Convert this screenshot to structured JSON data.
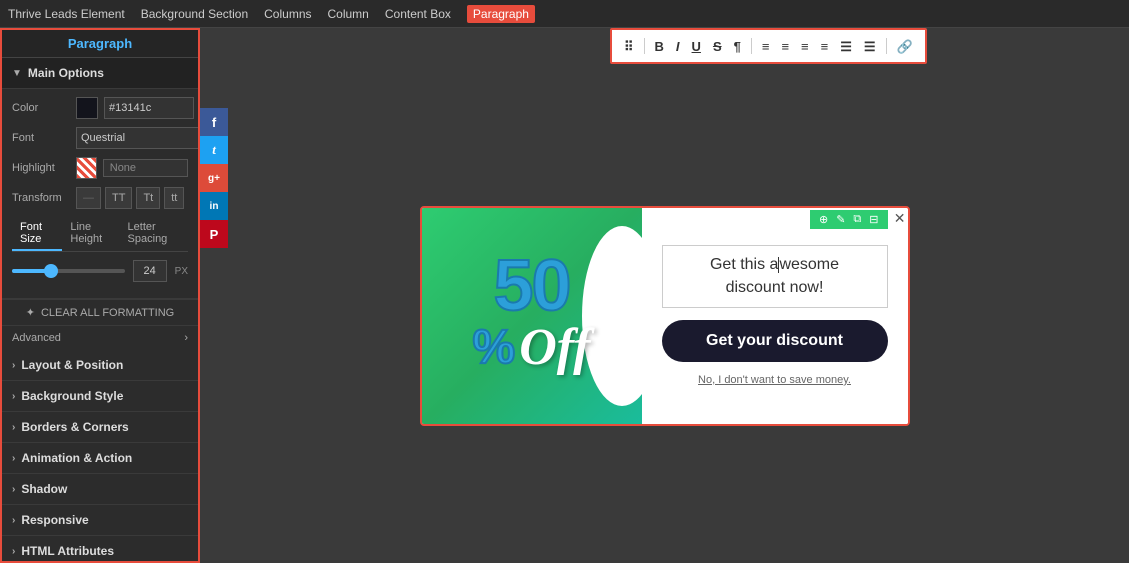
{
  "tabs": {
    "header": "Paragraph",
    "nav_items": [
      {
        "label": "Thrive Leads Element",
        "active": false
      },
      {
        "label": "Background Section",
        "active": false
      },
      {
        "label": "Columns",
        "active": false
      },
      {
        "label": "Column",
        "active": false
      },
      {
        "label": "Content Box",
        "active": false
      },
      {
        "label": "Paragraph",
        "active": true
      }
    ]
  },
  "toolbar": {
    "buttons": [
      "⠿",
      "B",
      "I",
      "U",
      "S",
      "¶",
      "≡",
      "≡",
      "≡",
      "≡",
      "☰",
      "☰",
      "🔗"
    ]
  },
  "sidebar": {
    "header": "Paragraph",
    "sections": {
      "main_options": {
        "label": "Main Options",
        "expanded": true,
        "color_label": "Color",
        "color_value": "#13141c",
        "font_label": "Font",
        "font_value": "Questrial",
        "highlight_label": "Highlight",
        "highlight_value": "None",
        "transform_label": "Transform",
        "transform_off_label": "—",
        "transform_tt": "TT",
        "transform_t1": "Tt",
        "transform_t2": "tt"
      },
      "font_tabs": [
        "Font Size",
        "Line Height",
        "Letter Spacing"
      ],
      "active_font_tab": "Font Size",
      "font_size_value": "24",
      "font_size_unit": "PX",
      "clear_formatting": "CLEAR ALL FORMATTING",
      "advanced_label": "Advanced"
    },
    "collapsed_sections": [
      {
        "label": "Layout & Position"
      },
      {
        "label": "Background Style"
      },
      {
        "label": "Borders & Corners"
      },
      {
        "label": "Animation & Action"
      },
      {
        "label": "Shadow"
      },
      {
        "label": "Responsive"
      },
      {
        "label": "HTML Attributes"
      }
    ]
  },
  "social": [
    {
      "label": "f",
      "class": "social-fb",
      "name": "facebook"
    },
    {
      "label": "t",
      "class": "social-tw",
      "name": "twitter"
    },
    {
      "label": "g+",
      "class": "social-gp",
      "name": "google-plus"
    },
    {
      "label": "in",
      "class": "social-li",
      "name": "linkedin"
    },
    {
      "label": "P",
      "class": "social-pi",
      "name": "pinterest"
    }
  ],
  "preview": {
    "headline_line1": "Get this a",
    "headline_cursor": "|",
    "headline_line2": "wesome",
    "headline_line3": "discount now!",
    "cta_button": "Get your discount",
    "decline_text": "No, I don't want to save money.",
    "discount_number": "50",
    "discount_percent": "%",
    "discount_off": "Off",
    "card_controls": [
      "⊞",
      "⊡",
      "⊟"
    ],
    "close_btn": "✕"
  }
}
